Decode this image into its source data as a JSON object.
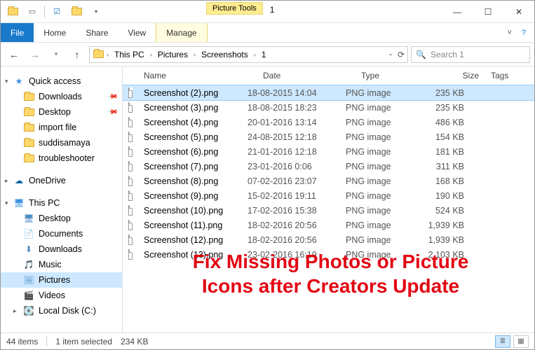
{
  "window": {
    "title": "1",
    "context_tab": "Picture Tools"
  },
  "ribbon": {
    "file": "File",
    "tabs": [
      "Home",
      "Share",
      "View"
    ],
    "context": "Manage"
  },
  "nav": {
    "breadcrumb": [
      "This PC",
      "Pictures",
      "Screenshots",
      "1"
    ],
    "search_placeholder": "Search 1"
  },
  "sidebar": {
    "quick_access": {
      "label": "Quick access",
      "items": [
        {
          "label": "Downloads",
          "pinned": true
        },
        {
          "label": "Desktop",
          "pinned": true
        },
        {
          "label": "import file"
        },
        {
          "label": "suddisamaya"
        },
        {
          "label": "troubleshooter"
        }
      ]
    },
    "onedrive": {
      "label": "OneDrive"
    },
    "this_pc": {
      "label": "This PC",
      "items": [
        {
          "label": "Desktop"
        },
        {
          "label": "Documents"
        },
        {
          "label": "Downloads"
        },
        {
          "label": "Music"
        },
        {
          "label": "Pictures",
          "selected": true
        },
        {
          "label": "Videos"
        },
        {
          "label": "Local Disk (C:)"
        }
      ]
    }
  },
  "columns": {
    "name": "Name",
    "date": "Date",
    "type": "Type",
    "size": "Size",
    "tags": "Tags"
  },
  "files": [
    {
      "name": "Screenshot (2).png",
      "date": "18-08-2015 14:04",
      "type": "PNG image",
      "size": "235 KB",
      "selected": true
    },
    {
      "name": "Screenshot (3).png",
      "date": "18-08-2015 18:23",
      "type": "PNG image",
      "size": "235 KB"
    },
    {
      "name": "Screenshot (4).png",
      "date": "20-01-2016 13:14",
      "type": "PNG image",
      "size": "486 KB"
    },
    {
      "name": "Screenshot (5).png",
      "date": "24-08-2015 12:18",
      "type": "PNG image",
      "size": "154 KB"
    },
    {
      "name": "Screenshot (6).png",
      "date": "21-01-2016 12:18",
      "type": "PNG image",
      "size": "181 KB"
    },
    {
      "name": "Screenshot (7).png",
      "date": "23-01-2016 0:06",
      "type": "PNG image",
      "size": "311 KB"
    },
    {
      "name": "Screenshot (8).png",
      "date": "07-02-2016 23:07",
      "type": "PNG image",
      "size": "168 KB"
    },
    {
      "name": "Screenshot (9).png",
      "date": "15-02-2016 19:11",
      "type": "PNG image",
      "size": "190 KB"
    },
    {
      "name": "Screenshot (10).png",
      "date": "17-02-2016 15:38",
      "type": "PNG image",
      "size": "524 KB"
    },
    {
      "name": "Screenshot (11).png",
      "date": "18-02-2016 20:56",
      "type": "PNG image",
      "size": "1,939 KB"
    },
    {
      "name": "Screenshot (12).png",
      "date": "18-02-2016 20:56",
      "type": "PNG image",
      "size": "1,939 KB"
    },
    {
      "name": "Screenshot (13).png",
      "date": "23-02-2016 16:19",
      "type": "PNG image",
      "size": "2,103 KB"
    }
  ],
  "status": {
    "count": "44 items",
    "selection": "1 item selected",
    "sel_size": "234 KB"
  },
  "overlay": {
    "line1": "Fix Missing Photos or Picture",
    "line2": "Icons after Creators Update"
  }
}
